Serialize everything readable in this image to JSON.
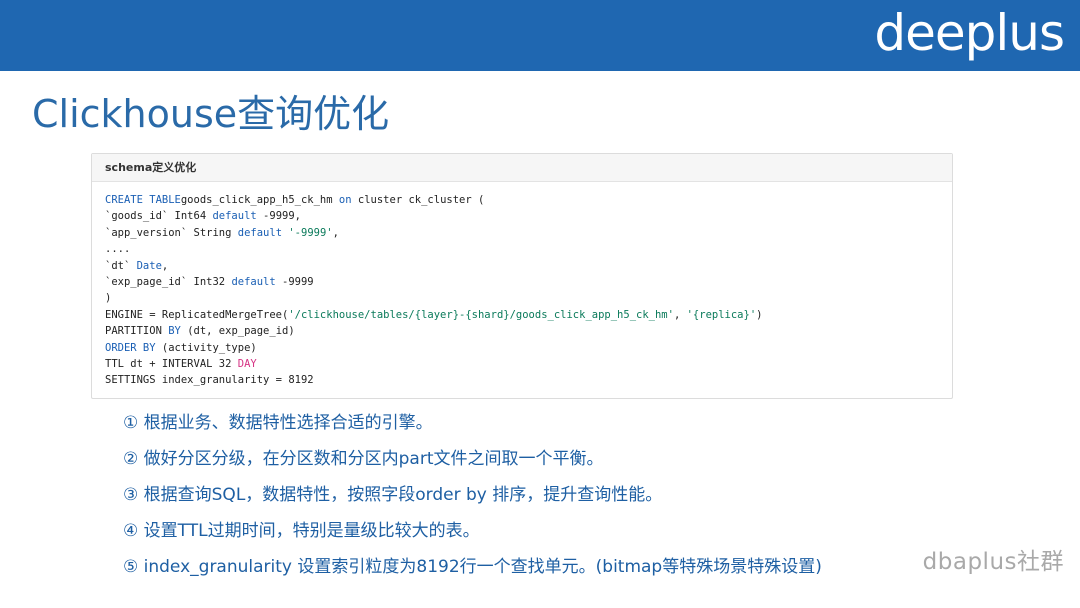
{
  "header": {
    "logo_text": "deeplus",
    "bar_color": "#1f67b1"
  },
  "title": "Clickhouse查询优化",
  "code_panel": {
    "heading": "schema定义优化",
    "keyword_color": "#1a5fb4",
    "string_color": "#0a7a5a",
    "special_color": "#d63384",
    "lines": [
      [
        [
          "kw",
          "CREATE TABLE"
        ],
        [
          "",
          "goods_click_app_h5_ck_hm "
        ],
        [
          "kw",
          "on"
        ],
        [
          "",
          " cluster ck_cluster ("
        ]
      ],
      [
        [
          "",
          "`goods_id` Int64 "
        ],
        [
          "kw",
          "default"
        ],
        [
          "",
          " -9999,"
        ]
      ],
      [
        [
          "",
          "`app_version` String "
        ],
        [
          "kw",
          "default"
        ],
        [
          "",
          " "
        ],
        [
          "str",
          "'-9999'"
        ],
        [
          "",
          ","
        ]
      ],
      [
        [
          "",
          "...."
        ]
      ],
      [
        [
          "",
          "`dt` "
        ],
        [
          "kw",
          "Date"
        ],
        [
          "",
          ","
        ]
      ],
      [
        [
          "",
          "`exp_page_id` Int32 "
        ],
        [
          "kw",
          "default"
        ],
        [
          "",
          " -9999"
        ]
      ],
      [
        [
          "",
          ")"
        ]
      ],
      [
        [
          "",
          "ENGINE = ReplicatedMergeTree("
        ],
        [
          "str",
          "'/clickhouse/tables/{layer}-{shard}/goods_click_app_h5_ck_hm'"
        ],
        [
          "",
          ", "
        ],
        [
          "str",
          "'{replica}'"
        ],
        [
          "",
          ")"
        ]
      ],
      [
        [
          "",
          "PARTITION "
        ],
        [
          "kw",
          "BY"
        ],
        [
          "",
          " (dt, exp_page_id)"
        ]
      ],
      [
        [
          "kw",
          "ORDER BY"
        ],
        [
          "",
          " (activity_type)"
        ]
      ],
      [
        [
          "",
          "TTL dt + INTERVAL 32 "
        ],
        [
          "sp",
          "DAY"
        ]
      ],
      [
        [
          "",
          "SETTINGS index_granularity = 8192"
        ]
      ]
    ]
  },
  "bullets": [
    "① 根据业务、数据特性选择合适的引擎。",
    "② 做好分区分级，在分区数和分区内part文件之间取一个平衡。",
    "③ 根据查询SQL，数据特性，按照字段order by 排序，提升查询性能。",
    "④ 设置TTL过期时间，特别是量级比较大的表。",
    "⑤ index_granularity 设置索引粒度为8192行一个查找单元。(bitmap等特殊场景特殊设置)"
  ],
  "watermark": "dbaplus社群"
}
